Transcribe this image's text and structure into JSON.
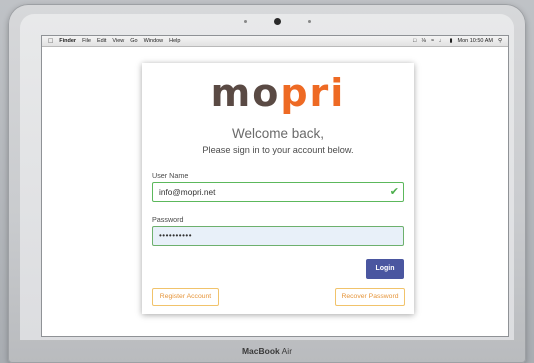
{
  "device": {
    "name_bold": "MacBook",
    "name_rest": " Air"
  },
  "menubar": {
    "apple_icon": "apple-logo-icon",
    "app_name": "Finder",
    "items": [
      "File",
      "Edit",
      "View",
      "Go",
      "Window",
      "Help"
    ],
    "clock": "Mon 10:50 AM",
    "status_icons": [
      "airplay-icon",
      "bluetooth-icon",
      "wifi-icon",
      "volume-icon",
      "battery-icon",
      "spotlight-search-icon"
    ]
  },
  "login": {
    "logo_part1": "mo",
    "logo_part2": "pri",
    "welcome": "Welcome back,",
    "subtitle": "Please sign in to your account below.",
    "username_label": "User Name",
    "username_value": "info@mopri.net",
    "password_label": "Password",
    "password_value": "••••••••••",
    "login_button": "Login",
    "register_button": "Register Account",
    "recover_button": "Recover Password"
  },
  "colors": {
    "logo_dark": "#5a4a44",
    "logo_accent": "#ee6a24",
    "login_button": "#4a56a0",
    "outline_button": "#f1c36b",
    "valid_border": "#5cb85c"
  }
}
